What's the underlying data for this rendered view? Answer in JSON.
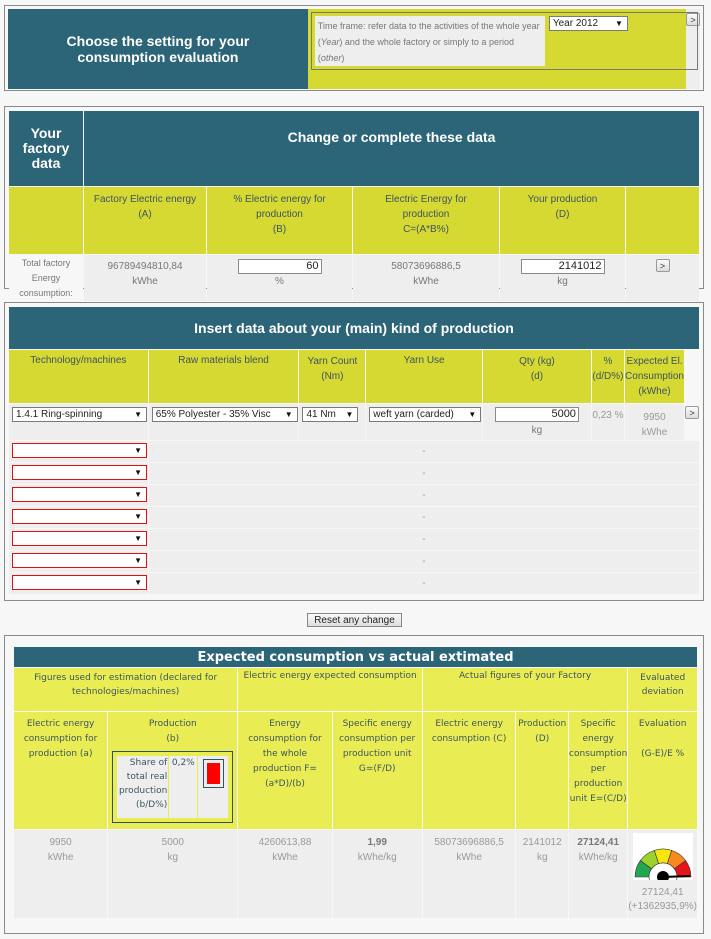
{
  "settings": {
    "title": "Choose the setting for your consumption evaluation",
    "timeframe_text_1": "Time frame: refer data to the activities of the whole year (",
    "timeframe_em_1": "Year",
    "timeframe_text_2": ") and the whole factory or simply to a period (",
    "timeframe_em_2": "other",
    "timeframe_text_3": ")",
    "timeframe_select": "Year 2012",
    "go_label": ">"
  },
  "factory": {
    "side_title": "Your factory data",
    "main_title": "Change or complete these data",
    "columns": [
      {
        "line1": "Factory Electric energy",
        "line2": "(A)"
      },
      {
        "line1": "% Electric energy for production",
        "line2": "(B)"
      },
      {
        "line1": "Electric Energy for production",
        "line2": "C=(A*B%)"
      },
      {
        "line1": "Your production",
        "line2": "(D)"
      }
    ],
    "row_label": "Total factory Energy consumption:",
    "factory_energy_value": "96789494810,84",
    "factory_energy_unit": "kWhe",
    "percent_value": "60",
    "percent_unit": "%",
    "energy_production_value": "58073696886,5",
    "energy_production_unit": "kWhe",
    "production_value": "2141012",
    "production_unit": "kg",
    "go_label": ">"
  },
  "production": {
    "title": "Insert data about your (main) kind of production",
    "columns": [
      "Technology/machines",
      "Raw materials blend",
      "Yarn Count (Nm)",
      "Yarn Use",
      "Qty (kg) (d)",
      "% (d/D%)",
      "Expected El. Consumption (kWhe)"
    ],
    "row": {
      "technology": "1.4.1 Ring-spinning",
      "blend": "65% Polyester - 35% Visc",
      "count": "41 Nm",
      "use": "weft yarn (carded)",
      "qty": "5000",
      "qty_unit": "kg",
      "percent": "0,23 %",
      "expected": "9950",
      "expected_unit": "kWhe",
      "go_label": ">"
    },
    "empty_rows": [
      "-",
      "-",
      "-",
      "-",
      "-",
      "-",
      "-"
    ]
  },
  "reset_label": "Reset any change",
  "results": {
    "title": "Expected consumption vs actual extimated",
    "groups": {
      "figures": "Figures used for estimation (declared for technologies/machines)",
      "expected": "Electric energy expected consumption",
      "actual": "Actual figures of your Factory",
      "deviation": "Evaluated deviation"
    },
    "headers": {
      "a": "Electric energy consumption for production (a)",
      "b_line1": "Production",
      "b_line2": "(b)",
      "share_label": "Share of total real production (b/D%)",
      "share_value": "0,2%",
      "f": "Energy consumption for the whole production F=(a*D)/(b)",
      "g": "Specific energy consumption per production unit G=(F/D)",
      "c": "Electric energy consumption (C)",
      "d": "Production (D)",
      "e": "Specific energy consumption per production unit E=(C/D)",
      "eval_line1": "Evaluation",
      "eval_line2": "(G-E)/E %"
    },
    "values": {
      "a": "9950",
      "a_unit": "kWhe",
      "b": "5000",
      "b_unit": "kg",
      "f": "4260613,88",
      "f_unit": "kWhe",
      "g": "1,99",
      "g_unit": "kWhe/kg",
      "c": "58073696886,5",
      "c_unit": "kWhe",
      "d": "2141012",
      "d_unit": "kg",
      "e": "27124,41",
      "e_unit": "kWhe/kg",
      "eval_value": "27124,41",
      "eval_pct": "(+1362935,9%)"
    },
    "gauge_colors": [
      "#21a84f",
      "#9dd12d",
      "#f5e60d",
      "#f7891f",
      "#e8141c"
    ],
    "share_bar_color": "#ff0000"
  }
}
